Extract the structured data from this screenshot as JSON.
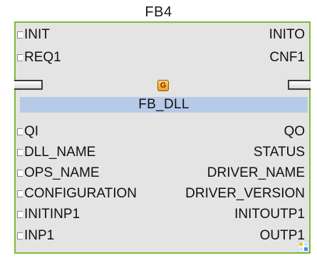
{
  "instance_name": "FB4",
  "type_name": "FB_DLL",
  "event_inputs": [
    "INIT",
    "REQ1"
  ],
  "event_outputs": [
    "INITO",
    "CNF1"
  ],
  "data_inputs": [
    "QI",
    "DLL_NAME",
    "OPS_NAME",
    "CONFIGURATION",
    "INITINP1",
    "INP1"
  ],
  "data_outputs": [
    "QO",
    "STATUS",
    "DRIVER_NAME",
    "DRIVER_VERSION",
    "INITOUTP1",
    "OUTP1"
  ],
  "type_icon": {
    "name": "g-icon",
    "glyph": "G"
  },
  "colors": {
    "border": "#7bbd3a",
    "body": "#e4e4e4",
    "type_bar": "#b7cbe8",
    "icon": "#f29b1d"
  }
}
